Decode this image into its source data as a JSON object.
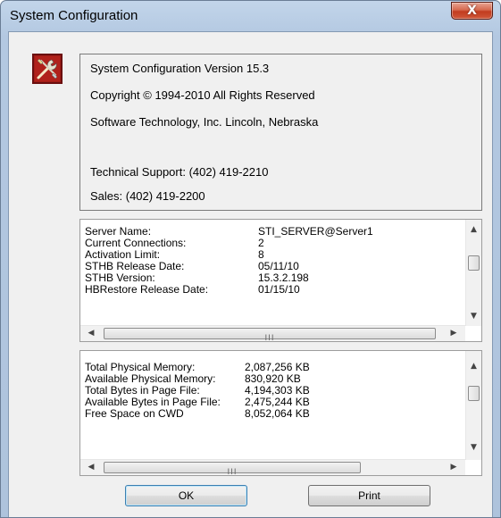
{
  "window": {
    "title": "System Configuration",
    "close_glyph": "X"
  },
  "info": {
    "version": "System Configuration Version 15.3",
    "copyright": "Copyright © 1994-2010  All Rights Reserved",
    "company": "Software Technology, Inc.  Lincoln, Nebraska",
    "support": "Technical Support:  (402) 419-2210",
    "sales": "Sales:  (402) 419-2200"
  },
  "server_list": {
    "rows": [
      {
        "label": "Server Name:",
        "value": "STI_SERVER@Server1"
      },
      {
        "label": "Current Connections:",
        "value": "2"
      },
      {
        "label": "Activation Limit:",
        "value": "8"
      },
      {
        "label": "STHB Release Date:",
        "value": "05/11/10"
      },
      {
        "label": "STHB Version:",
        "value": "15.3.2.198"
      },
      {
        "label": "HBRestore Release Date:",
        "value": "01/15/10"
      }
    ]
  },
  "memory_list": {
    "rows": [
      {
        "label": "Total Physical Memory:",
        "value": "2,087,256 KB"
      },
      {
        "label": "Available Physical Memory:",
        "value": "830,920 KB"
      },
      {
        "label": "Total Bytes in Page File:",
        "value": "4,194,303 KB"
      },
      {
        "label": "Available Bytes in Page File:",
        "value": "2,475,244 KB"
      },
      {
        "label": "Free Space on CWD",
        "value": "8,052,064 KB"
      }
    ]
  },
  "scroll": {
    "up_glyph": "▲",
    "down_glyph": "▼",
    "left_glyph": "◀",
    "right_glyph": "▶",
    "grip_glyph": "III"
  },
  "buttons": {
    "ok_label": "OK",
    "print_label": "Print"
  },
  "icons": {
    "app_icon": "tools-wrench-icon"
  }
}
